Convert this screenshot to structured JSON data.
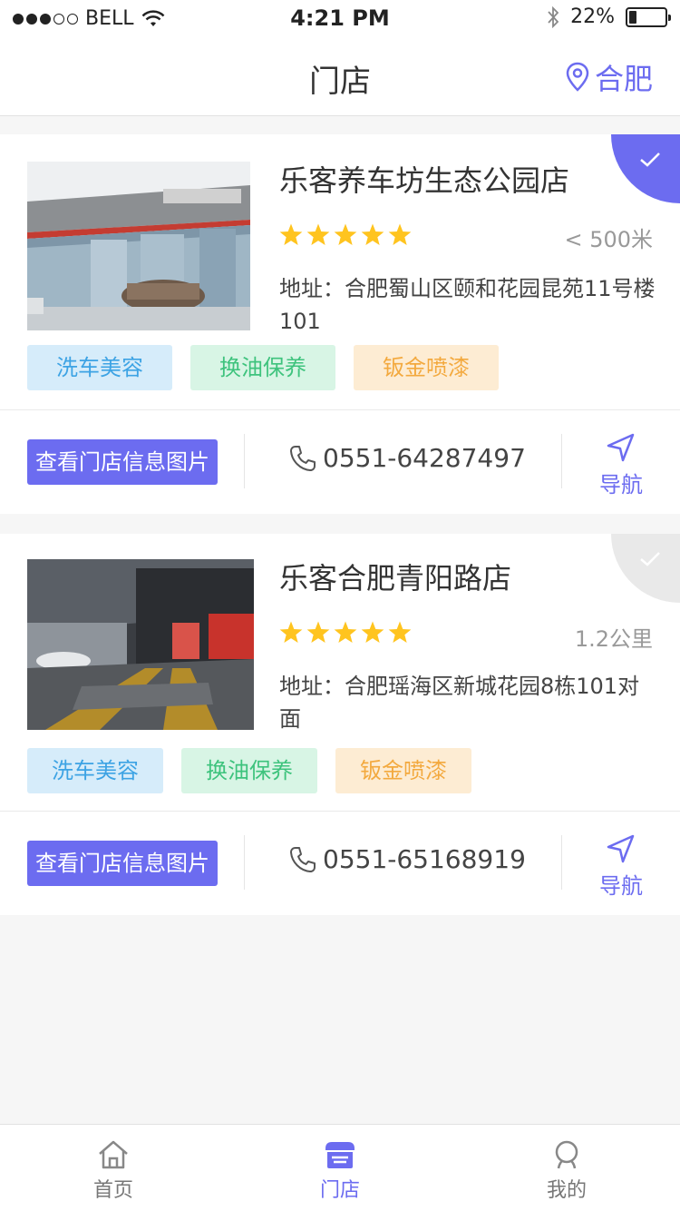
{
  "status_bar": {
    "carrier": "BELL",
    "time": "4:21 PM",
    "battery": "22%",
    "battery_level": 0.22
  },
  "header": {
    "title": "门店",
    "location": "合肥"
  },
  "stores": [
    {
      "name": "乐客养车坊生态公园店",
      "rating": 5,
      "distance": "< 500米",
      "address": "地址：合肥蜀山区颐和花园昆苑11号楼101",
      "selected": true,
      "tags": [
        "洗车美容",
        "换油保养",
        "钣金喷漆"
      ],
      "info_button": "查看门店信息图片",
      "phone": "0551-64287497",
      "nav_label": "导航"
    },
    {
      "name": "乐客合肥青阳路店",
      "rating": 5,
      "distance": "1.2公里",
      "address": "地址：合肥瑶海区新城花园8栋101对面",
      "selected": false,
      "tags": [
        "洗车美容",
        "换油保养",
        "钣金喷漆"
      ],
      "info_button": "查看门店信息图片",
      "phone": "0551-65168919",
      "nav_label": "导航"
    }
  ],
  "tabbar": {
    "items": [
      {
        "label": "首页",
        "icon": "home-icon"
      },
      {
        "label": "门店",
        "icon": "store-icon",
        "active": true
      },
      {
        "label": "我的",
        "icon": "profile-icon"
      }
    ]
  },
  "colors": {
    "accent": "#6c6cf0",
    "star": "#ffc41f"
  }
}
